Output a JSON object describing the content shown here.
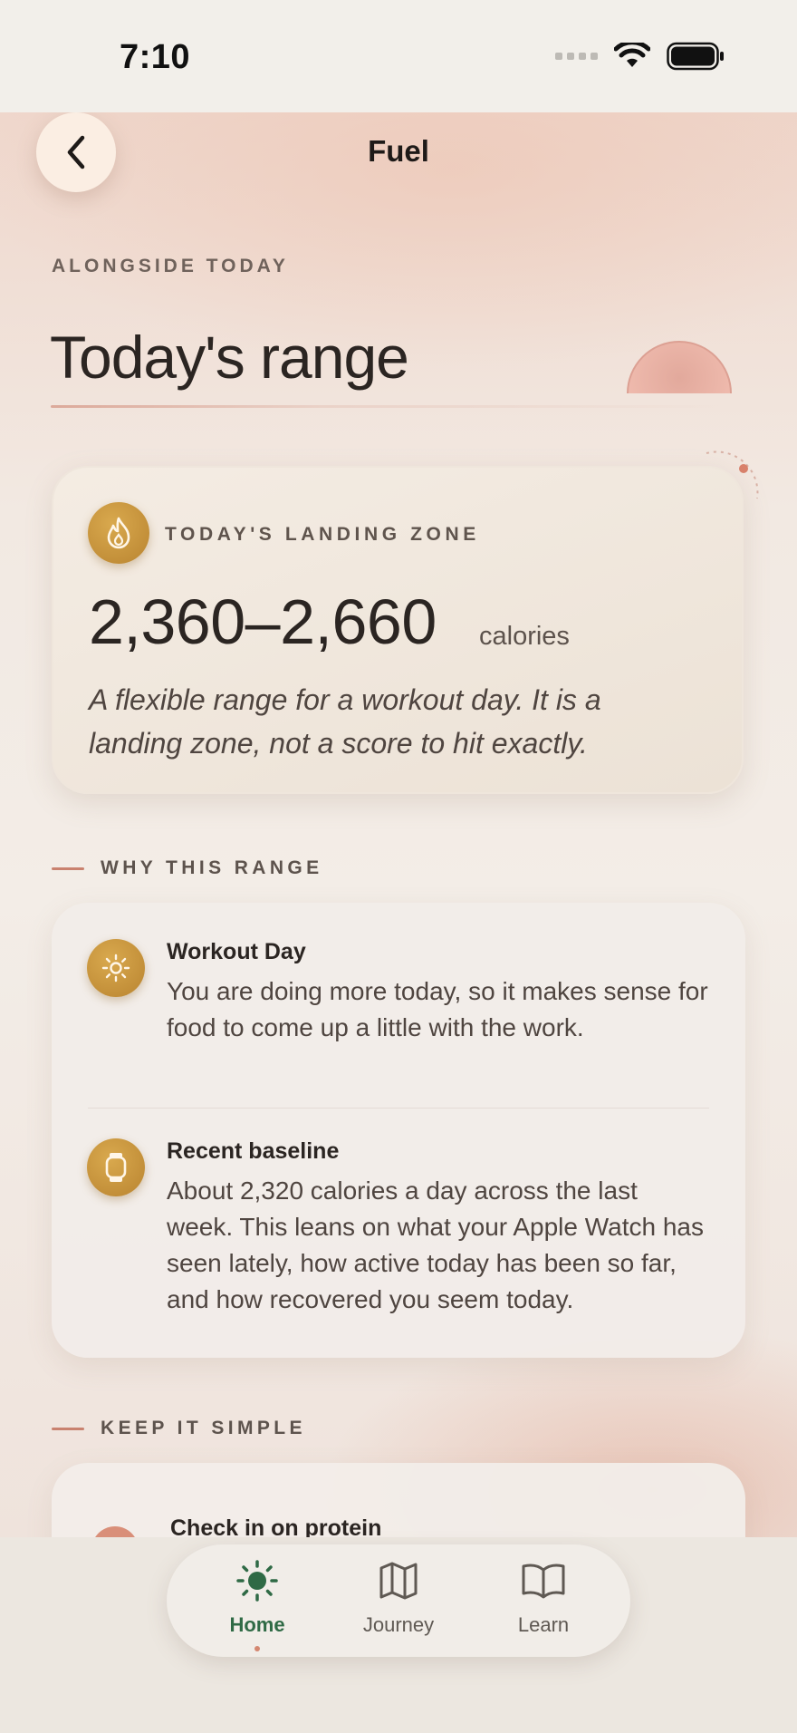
{
  "status_bar": {
    "time": "7:10"
  },
  "header": {
    "title": "Fuel",
    "back_icon": "chevron-left-icon"
  },
  "page": {
    "eyebrow": "ALONGSIDE TODAY",
    "title": "Today's range"
  },
  "landing_zone": {
    "icon": "flame-icon",
    "label": "TODAY'S LANDING ZONE",
    "value": "2,360–2,660",
    "unit": "calories",
    "description": "A flexible range for a workout day. It is a landing zone, not a score to hit exactly."
  },
  "why_section": {
    "heading": "WHY THIS RANGE",
    "items": [
      {
        "icon": "sun-icon",
        "title": "Workout Day",
        "body": "You are doing more today, so it makes sense for food to come up a little with the work."
      },
      {
        "icon": "watch-icon",
        "title": "Recent baseline",
        "body": "About 2,320 calories a day across the last week. This leans on what your Apple Watch has seen lately, how active today has been so far, and how recovered you seem today."
      }
    ]
  },
  "simple_section": {
    "heading": "KEEP IT SIMPLE",
    "items": [
      {
        "title": "Check in on protein"
      }
    ]
  },
  "tab_bar": {
    "tabs": [
      {
        "label": "Home",
        "icon": "sun-icon",
        "active": true
      },
      {
        "label": "Journey",
        "icon": "map-icon",
        "active": false
      },
      {
        "label": "Learn",
        "icon": "book-open-icon",
        "active": false
      }
    ]
  },
  "colors": {
    "accent_gold": "#c4943c",
    "accent_green": "#2f6a45",
    "accent_rose": "#c9826f"
  }
}
